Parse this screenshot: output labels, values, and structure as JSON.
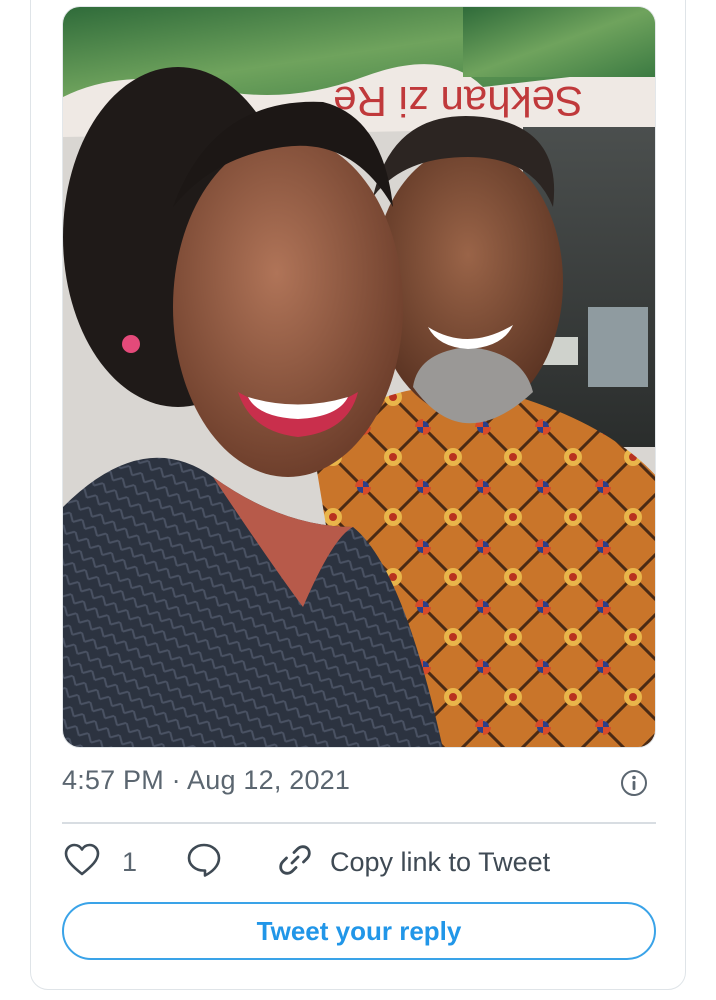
{
  "tweet": {
    "timestamp": "4:57 PM · Aug 12, 2021",
    "photo": {
      "alt": "",
      "sign_text": "Sekhan zi Re"
    },
    "actions": {
      "like_count": "1",
      "copy_link_label": "Copy link to Tweet"
    },
    "reply_button_label": "Tweet your reply"
  },
  "icons": {
    "like": "heart-icon",
    "reply": "speech-bubble-icon",
    "copy_link": "link-icon",
    "info": "info-icon"
  },
  "colors": {
    "accent": "#1d9bf0",
    "muted_text": "#5b6670",
    "divider": "#d8dde2"
  }
}
